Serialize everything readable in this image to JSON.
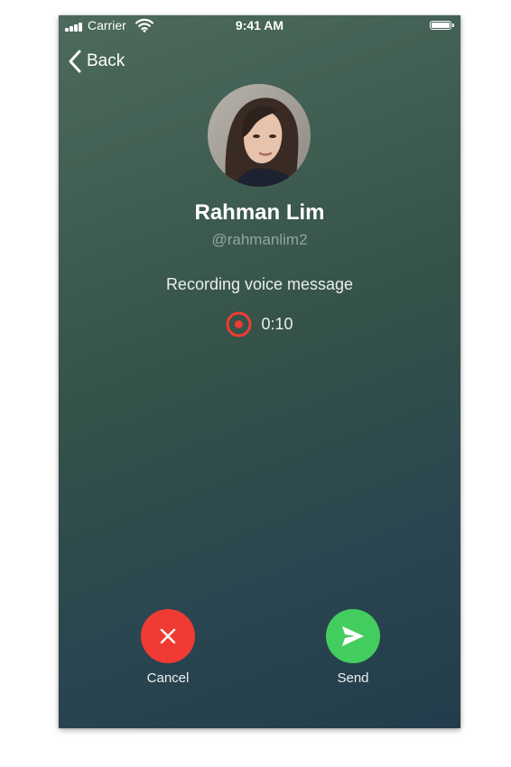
{
  "status_bar": {
    "carrier": "Carrier",
    "time": "9:41 AM",
    "signal_icon": "cellular-signal-icon",
    "wifi_icon": "wifi-icon",
    "battery_icon": "battery-icon"
  },
  "nav": {
    "back_label": "Back",
    "back_icon": "chevron-left-icon"
  },
  "contact": {
    "name": "Rahman Lim",
    "handle": "@rahmanlim2"
  },
  "recording": {
    "status_text": "Recording voice message",
    "elapsed": "0:10",
    "icon": "record-icon",
    "accent_color": "#ef3b33"
  },
  "actions": {
    "cancel": {
      "label": "Cancel",
      "icon": "close-icon",
      "color": "#ef3b33"
    },
    "send": {
      "label": "Send",
      "icon": "send-icon",
      "color": "#43cd5e"
    }
  }
}
